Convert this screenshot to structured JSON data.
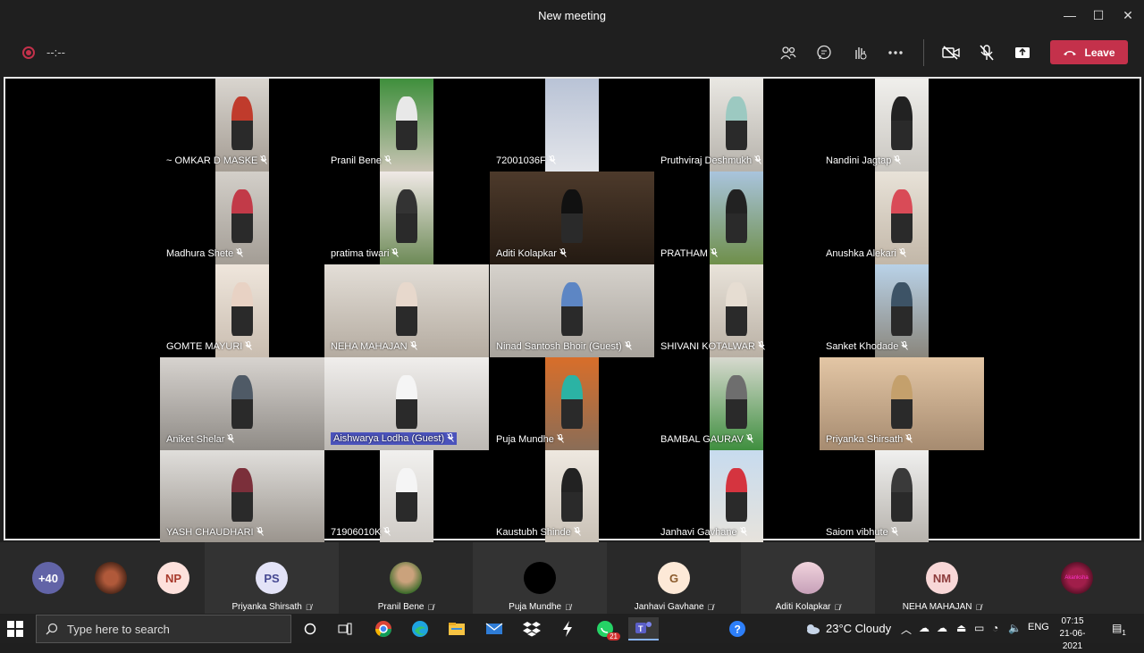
{
  "window": {
    "title": "New meeting",
    "minimize": "—",
    "maximize": "☐",
    "close": "✕"
  },
  "toolbar": {
    "timer": "--:--",
    "leave_label": "Leave",
    "accent": "#c4314b"
  },
  "tiles": [
    {
      "name": "~ OMKAR D MASKE",
      "icon": "mic-off-icon"
    },
    {
      "name": "Pranil Bene",
      "icon": "mic-off-icon"
    },
    {
      "name": "72001036F",
      "icon": "mic-off-icon"
    },
    {
      "name": "Pruthviraj Deshmukh",
      "icon": "mic-off-icon"
    },
    {
      "name": "Nandini Jagtap",
      "icon": "mic-off-icon"
    },
    {
      "name": "Madhura  Shete",
      "icon": "mic-off-icon"
    },
    {
      "name": "pratima tiwari",
      "icon": "mic-off-icon"
    },
    {
      "name": "Aditi Kolapkar",
      "icon": "mic-off-icon"
    },
    {
      "name": "PRATHAM",
      "icon": "mic-off-icon"
    },
    {
      "name": "Anushka Alekari",
      "icon": "mic-off-icon"
    },
    {
      "name": "GOMTE MAYURI",
      "icon": "mic-off-icon"
    },
    {
      "name": "NEHA MAHAJAN",
      "icon": "mic-off-icon"
    },
    {
      "name": "Ninad Santosh Bhoir (Guest)",
      "icon": "mic-off-icon"
    },
    {
      "name": "SHIVANI KOTALWAR",
      "icon": "mic-off-icon"
    },
    {
      "name": "Sanket Khodade",
      "icon": "mic-off-icon"
    },
    {
      "name": "Aniket Shelar",
      "icon": "mic-off-icon"
    },
    {
      "name": "Aishwarya Lodha (Guest)",
      "icon": "mic-off-icon"
    },
    {
      "name": "Puja Mundhe",
      "icon": "mic-off-icon"
    },
    {
      "name": "BAMBAL GAURAV",
      "icon": "mic-off-icon"
    },
    {
      "name": "Priyanka Shirsath",
      "icon": "mic-off-icon"
    },
    {
      "name": "YASH CHAUDHARI",
      "icon": "mic-off-icon"
    },
    {
      "name": "71906010K",
      "icon": "mic-off-icon"
    },
    {
      "name": "Kaustubh Shinde",
      "icon": "mic-off-icon"
    },
    {
      "name": "Janhavi Gavhane",
      "icon": "mic-off-icon"
    },
    {
      "name": "Saiom vibhute",
      "icon": "mic-off-icon"
    }
  ],
  "participant_bar": {
    "overflow": "+40",
    "np_initials": "NP",
    "slots": [
      {
        "initials": "PS",
        "name": "Priyanka Shirsath"
      },
      {
        "initials": "",
        "name": "Pranil Bene"
      },
      {
        "initials": "",
        "name": "Puja Mundhe"
      },
      {
        "initials": "G",
        "name": "Janhavi Gavhane"
      },
      {
        "initials": "",
        "name": "Aditi Kolapkar"
      },
      {
        "initials": "NM",
        "name": "NEHA MAHAJAN"
      }
    ],
    "last_avatar_text": "Akanksha"
  },
  "taskbar": {
    "search_placeholder": "Type here to search",
    "weather": "23°C  Cloudy",
    "language": "ENG",
    "time": "07:15",
    "date": "21-06-2021",
    "whatsapp_badge": "21",
    "notification_badge": "1"
  }
}
